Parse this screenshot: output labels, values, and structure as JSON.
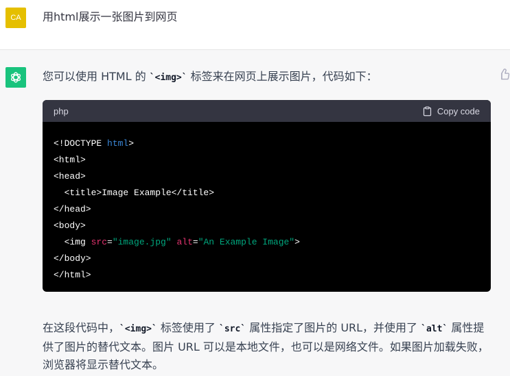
{
  "user": {
    "avatar_initials": "CA",
    "message": "用html展示一张图片到网页"
  },
  "assistant": {
    "intro_before": "您可以使用 HTML 的 ",
    "intro_code": "`<img>`",
    "intro_after": " 标签来在网页上展示图片，代码如下：",
    "code": {
      "language": "php",
      "copy_label": "Copy code",
      "lines": {
        "l1_a": "<!DOCTYPE ",
        "l1_b": "html",
        "l1_c": ">",
        "l2": "<html>",
        "l3": "<head>",
        "l4": "  <title>Image Example</title>",
        "l5": "</head>",
        "l6": "<body>",
        "l7_a": "  <img ",
        "l7_attr1": "src",
        "l7_eq1": "=",
        "l7_val1": "\"image.jpg\"",
        "l7_sp": " ",
        "l7_attr2": "alt",
        "l7_eq2": "=",
        "l7_val2": "\"An Example Image\"",
        "l7_end": ">",
        "l8": "</body>",
        "l9": "</html>"
      }
    },
    "outro": {
      "p1": "在这段代码中，",
      "c1": "`<img>`",
      "p2": " 标签使用了 ",
      "c2": "`src`",
      "p3": " 属性指定了图片的 URL，并使用了 ",
      "c3": "`alt`",
      "p4": " 属性提供了图片的替代文本。图片 URL 可以是本地文件，也可以是网络文件。如果图片加载失败，浏览器将显示替代文本。"
    }
  },
  "colors": {
    "user_avatar": "#e5bf00",
    "bot_avatar": "#19c37d",
    "code_header": "#343541",
    "code_bg": "#000000",
    "keyword": "#3a86d6",
    "attribute": "#e3336f",
    "string": "#00a67d"
  },
  "icons": {
    "bot": "openai-logo-icon",
    "copy": "clipboard-icon",
    "feedback": "thumbs-up-icon"
  }
}
